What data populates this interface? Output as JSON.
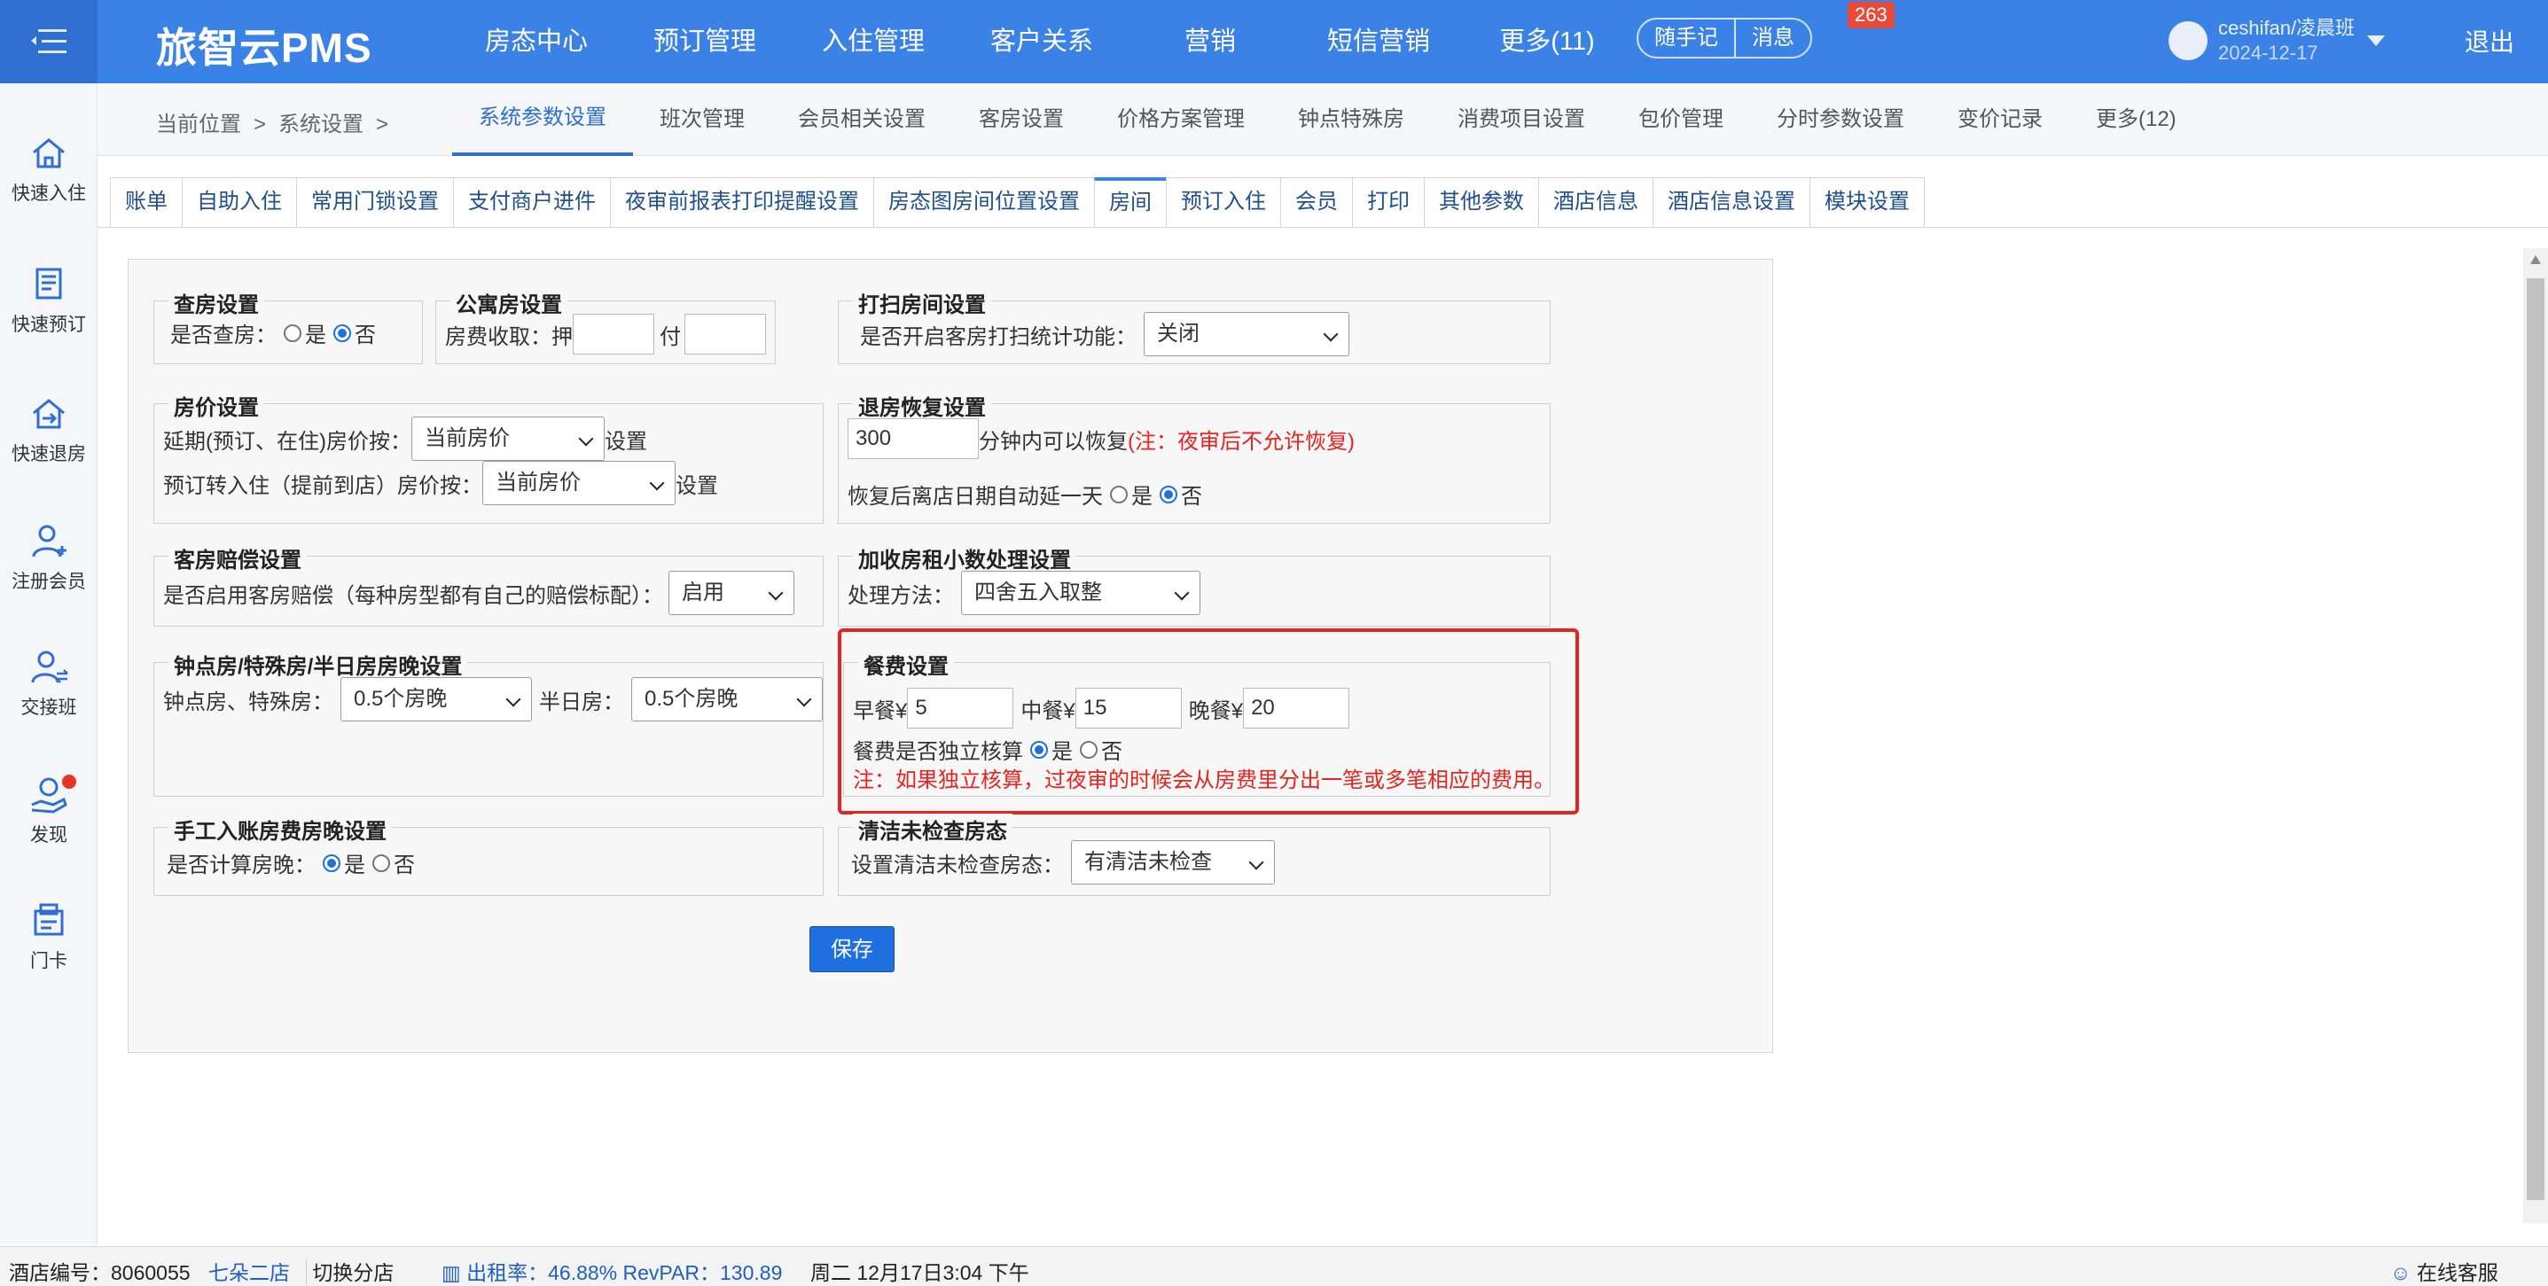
{
  "header": {
    "brand": "旅智云PMS",
    "nav": [
      "房态中心",
      "预订管理",
      "入住管理",
      "客户关系",
      "营销",
      "短信营销",
      "更多(11)"
    ],
    "notes_btn": "随手记",
    "msg_btn": "消息",
    "msg_count": "263",
    "user": "ceshifan/凌晨班",
    "date": "2024-12-17",
    "logout": "退出"
  },
  "sidebar": [
    "快速入住",
    "快速预订",
    "快速退房",
    "注册会员",
    "交接班",
    "发现",
    "门卡"
  ],
  "breadcrumb": {
    "current": "当前位置",
    "sep": ">",
    "section": "系统设置",
    "sep2": ">"
  },
  "module_tabs": [
    "系统参数设置",
    "班次管理",
    "会员相关设置",
    "客房设置",
    "价格方案管理",
    "钟点特殊房",
    "消费项目设置",
    "包价管理",
    "分时参数设置",
    "变价记录",
    "更多(12)"
  ],
  "sub_tabs": [
    "账单",
    "自助入住",
    "常用门锁设置",
    "支付商户进件",
    "夜审前报表打印提醒设置",
    "房态图房间位置设置",
    "房间",
    "预订入住",
    "会员",
    "打印",
    "其他参数",
    "酒店信息",
    "酒店信息设置",
    "模块设置"
  ],
  "form": {
    "check_room": {
      "title": "查房设置",
      "label": "是否查房：",
      "yes": "是",
      "no": "否"
    },
    "apartment": {
      "title": "公寓房设置",
      "label": "房费收取：押",
      "pay": "付"
    },
    "clean": {
      "title": "打扫房间设置",
      "label": "是否开启客房打扫统计功能：",
      "value": "关闭"
    },
    "price": {
      "title": "房价设置",
      "row1": "延期(预订、在住)房价按：",
      "row1_value": "当前房价",
      "row1_suffix": "设置",
      "row2": "预订转入住（提前到店）房价按：",
      "row2_value": "当前房价",
      "row2_suffix": "设置"
    },
    "checkout_restore": {
      "title": "退房恢复设置",
      "minutes": "300",
      "label": "分钟内可以恢复",
      "note": "(注：夜审后不允许恢复)",
      "row2": "恢复后离店日期自动延一天",
      "yes": "是",
      "no": "否"
    },
    "compensation": {
      "title": "客房赔偿设置",
      "label": "是否启用客房赔偿（每种房型都有自己的赔偿标配）：",
      "value": "启用"
    },
    "decimal": {
      "title": "加收房租小数处理设置",
      "label": "处理方法：",
      "value": "四舍五入取整"
    },
    "hourly": {
      "title": "钟点房/特殊房/半日房房晚设置",
      "label": "钟点房、特殊房：",
      "value": "0.5个房晚",
      "half_label": "半日房：",
      "half_value": "0.5个房晚"
    },
    "meal": {
      "title": "餐费设置",
      "breakfast": "早餐¥",
      "breakfast_value": "5",
      "lunch": "中餐¥",
      "lunch_value": "15",
      "dinner": "晚餐¥",
      "dinner_value": "20",
      "independent": "餐费是否独立核算",
      "yes": "是",
      "no": "否",
      "note": "注：如果独立核算，过夜审的时候会从房费里分出一笔或多笔相应的费用。"
    },
    "manual": {
      "title": "手工入账房费房晚设置",
      "label": "是否计算房晚：",
      "yes": "是",
      "no": "否"
    },
    "uninspected": {
      "title": "清洁未检查房态",
      "label": "设置清洁未检查房态：",
      "value": "有清洁未检查"
    },
    "save": "保存"
  },
  "statusbar": {
    "hotel_label": "酒店编号：",
    "hotel_no": "8060055",
    "branch": "七朵二店",
    "switch": "切换分店",
    "occupancy": "出租率：46.88% RevPAR：130.89",
    "datetime": "周二 12月17日3:04 下午",
    "service": "在线客服"
  }
}
